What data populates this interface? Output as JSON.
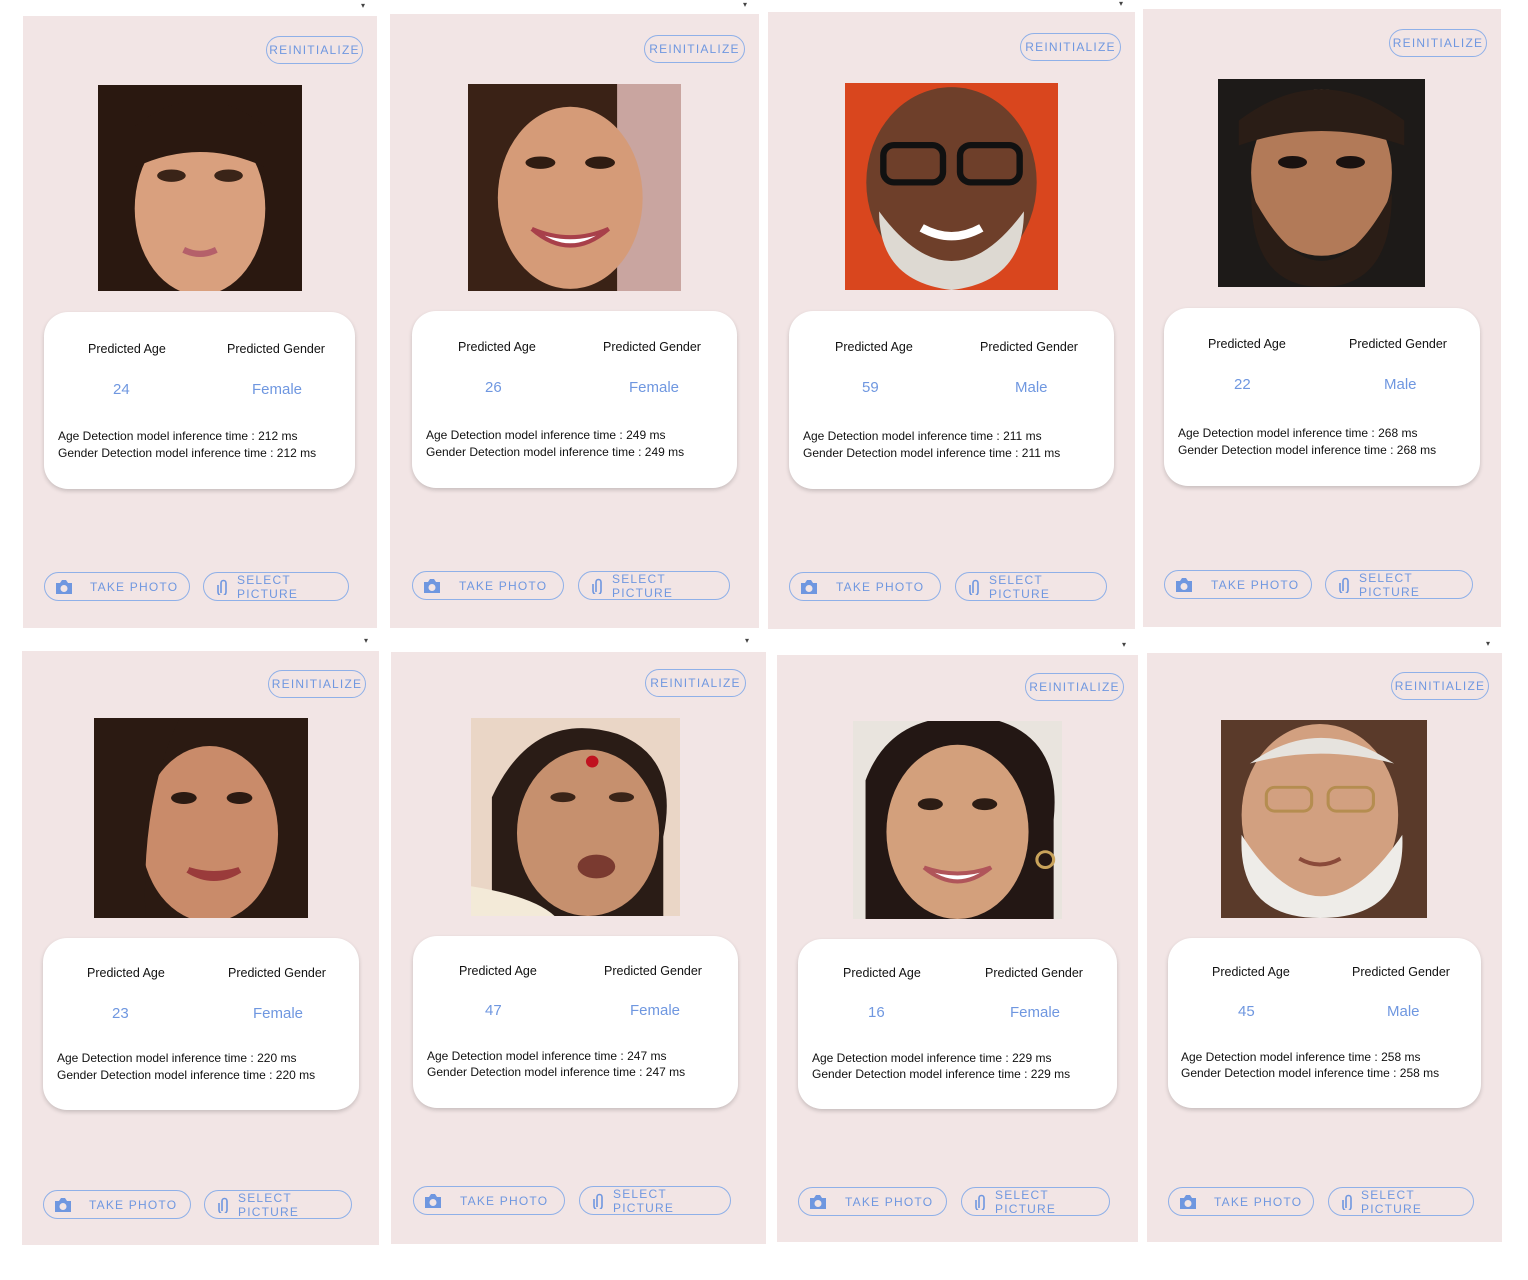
{
  "labels": {
    "reinitialize": "REINITIALIZE",
    "predicted_age": "Predicted Age",
    "predicted_gender": "Predicted Gender",
    "take_photo": "TAKE PHOTO",
    "select_picture": "SELECT PICTURE"
  },
  "icons": {
    "camera": "camera-icon",
    "attach": "paperclip-icon"
  },
  "colors": {
    "accent": "#6f97e0",
    "panel_bg": "#f2e5e5",
    "card_bg": "#ffffff"
  },
  "screens": [
    {
      "age": "24",
      "gender": "Female",
      "age_time": "Age Detection model inference time : 212 ms",
      "gender_time": "Gender Detection model inference time : 212 ms"
    },
    {
      "age": "26",
      "gender": "Female",
      "age_time": "Age Detection model inference time : 249 ms",
      "gender_time": "Gender Detection model inference time : 249 ms"
    },
    {
      "age": "59",
      "gender": "Male",
      "age_time": "Age Detection model inference time : 211 ms",
      "gender_time": "Gender Detection model inference time : 211 ms"
    },
    {
      "age": "22",
      "gender": "Male",
      "age_time": "Age Detection model inference time : 268 ms",
      "gender_time": "Gender Detection model inference time : 268 ms"
    },
    {
      "age": "23",
      "gender": "Female",
      "age_time": "Age Detection model inference time : 220 ms",
      "gender_time": "Gender Detection model inference time : 220 ms"
    },
    {
      "age": "47",
      "gender": "Female",
      "age_time": "Age Detection model inference time : 247 ms",
      "gender_time": "Gender Detection model inference time : 247 ms"
    },
    {
      "age": "16",
      "gender": "Female",
      "age_time": "Age Detection model inference time : 229 ms",
      "gender_time": "Gender Detection model inference time : 229 ms"
    },
    {
      "age": "45",
      "gender": "Male",
      "age_time": "Age Detection model inference time : 258 ms",
      "gender_time": "Gender Detection model inference time : 258 ms"
    }
  ]
}
